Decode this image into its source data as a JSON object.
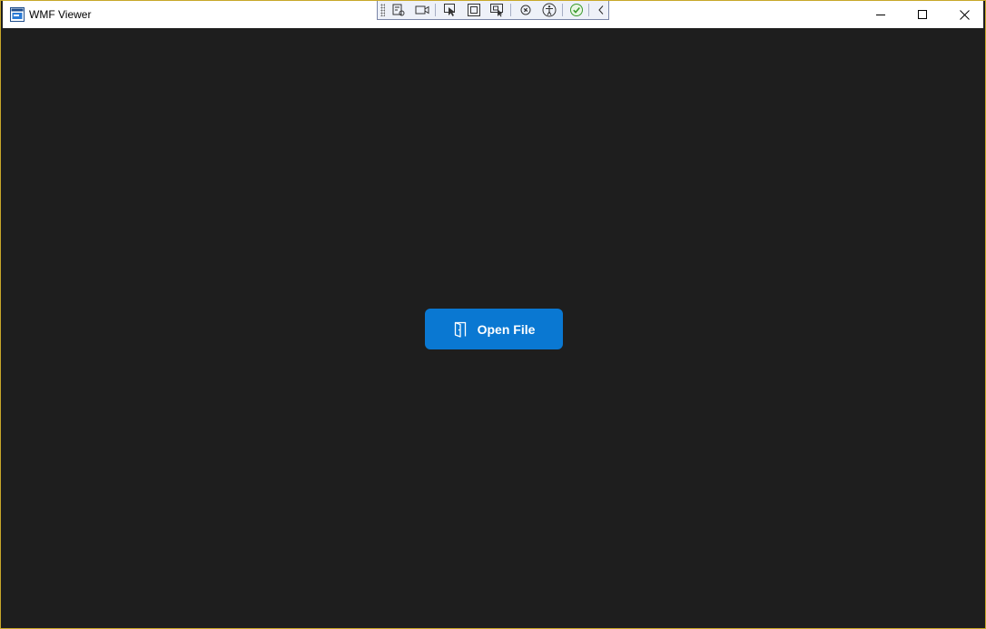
{
  "window": {
    "title": "WMF Viewer",
    "icon": "app-window-icon",
    "border_color": "#c8a82a",
    "background_color": "#1e1e1e",
    "titlebar_color": "#ffffff"
  },
  "caption_buttons": {
    "minimize": "minimize-icon",
    "maximize": "maximize-icon",
    "close": "close-icon"
  },
  "dev_toolbar": {
    "items": [
      "live-visual-tree-icon",
      "record-video-icon",
      "select-element-icon",
      "display-layout-adorners-icon",
      "track-focused-element-icon",
      "hot-reload-icon",
      "accessibility-icon",
      "binding-status-check-icon",
      "collapse-toolbar-icon"
    ]
  },
  "main": {
    "open_button": {
      "label": "Open File",
      "icon": "open-door-icon",
      "color": "#0a78d2"
    }
  }
}
